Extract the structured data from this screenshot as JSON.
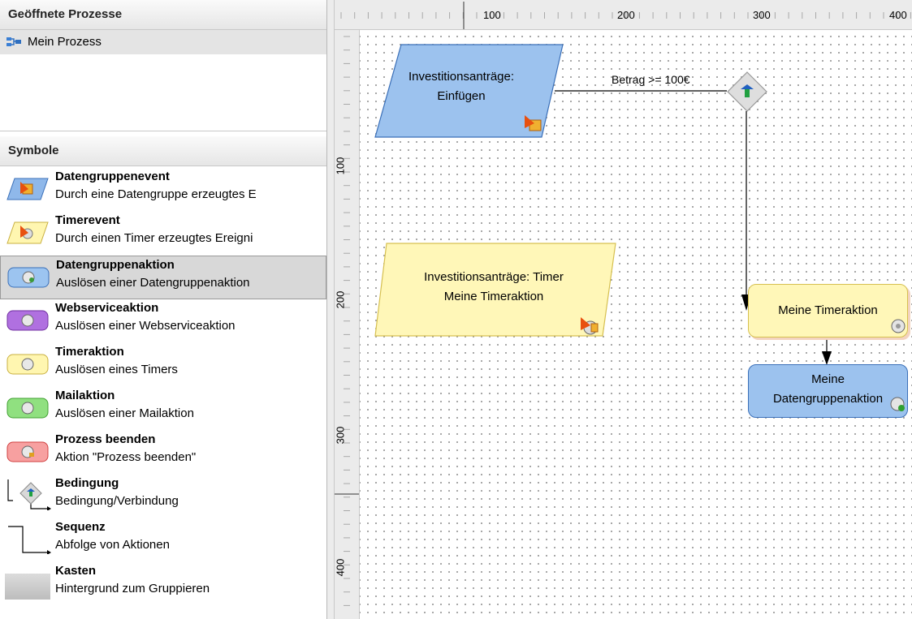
{
  "open_processes": {
    "header": "Geöffnete Prozesse",
    "items": [
      {
        "label": "Mein Prozess",
        "icon": "process-tree-icon"
      }
    ]
  },
  "symbols": {
    "header": "Symbole",
    "items": [
      {
        "title": "Datengruppenevent",
        "desc": "Durch eine Datengruppe erzeugtes E",
        "icon": "datagroup-event-icon"
      },
      {
        "title": "Timerevent",
        "desc": "Durch einen Timer erzeugtes Ereigni",
        "icon": "timer-event-icon"
      },
      {
        "title": "Datengruppenaktion",
        "desc": "Auslösen einer Datengruppenaktion",
        "icon": "datagroup-action-icon",
        "selected": true
      },
      {
        "title": "Webserviceaktion",
        "desc": "Auslösen einer Webserviceaktion",
        "icon": "webservice-action-icon"
      },
      {
        "title": "Timeraktion",
        "desc": "Auslösen eines Timers",
        "icon": "timer-action-icon"
      },
      {
        "title": "Mailaktion",
        "desc": "Auslösen einer Mailaktion",
        "icon": "mail-action-icon"
      },
      {
        "title": "Prozess beenden",
        "desc": "Aktion \"Prozess beenden\"",
        "icon": "end-process-icon"
      },
      {
        "title": "Bedingung",
        "desc": "Bedingung/Verbindung",
        "icon": "condition-icon"
      },
      {
        "title": "Sequenz",
        "desc": "Abfolge von Aktionen",
        "icon": "sequence-icon"
      },
      {
        "title": "Kasten",
        "desc": "Hintergrund zum Gruppieren",
        "icon": "box-icon"
      }
    ]
  },
  "ruler": {
    "top_labels": [
      "100",
      "200",
      "300",
      "400"
    ],
    "left_labels": [
      "100",
      "200",
      "300",
      "400"
    ]
  },
  "diagram": {
    "event_datagroup": {
      "line1": "Investitionsanträge:",
      "line2": "Einfügen"
    },
    "event_timer": {
      "line1": "Investitionsanträge: Timer",
      "line2": "Meine Timeraktion"
    },
    "condition_label": "Betrag >= 100€",
    "action_timer": "Meine Timeraktion",
    "action_datagroup": {
      "line1": "Meine",
      "line2": "Datengruppenaktion"
    }
  }
}
